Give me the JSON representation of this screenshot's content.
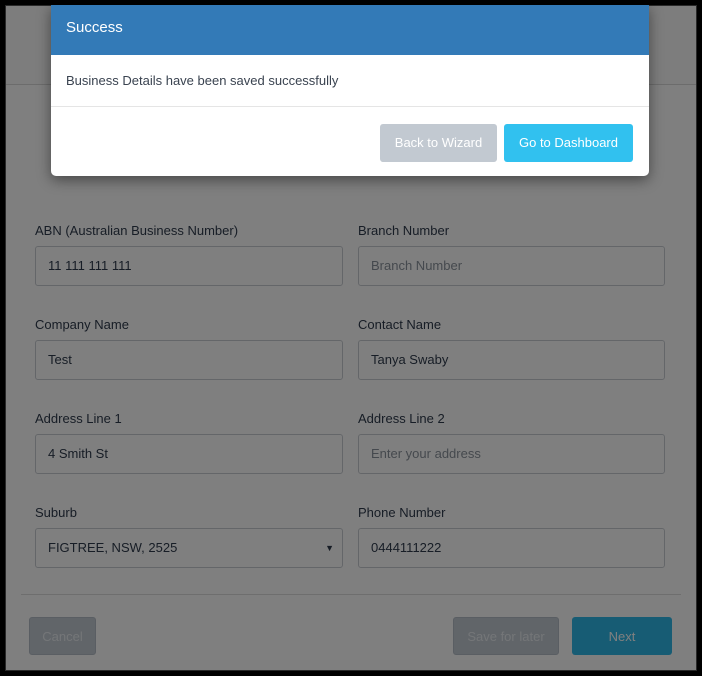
{
  "form": {
    "fields": [
      {
        "label": "ABN (Australian Business Number)",
        "value": "11 111 111 111",
        "placeholder": ""
      },
      {
        "label": "Branch Number",
        "value": "",
        "placeholder": "Branch Number"
      },
      {
        "label": "Company Name",
        "value": "Test",
        "placeholder": ""
      },
      {
        "label": "Contact Name",
        "value": "Tanya Swaby",
        "placeholder": ""
      },
      {
        "label": "Address Line 1",
        "value": "4 Smith St",
        "placeholder": ""
      },
      {
        "label": "Address Line 2",
        "value": "",
        "placeholder": "Enter your address"
      },
      {
        "label": "Suburb",
        "value": "FIGTREE, NSW, 2525",
        "placeholder": "",
        "caret": "▼"
      },
      {
        "label": "Phone Number",
        "value": "0444111222",
        "placeholder": ""
      }
    ],
    "buttons": {
      "cancel": "Cancel",
      "save_for_later": "Save for later",
      "next": "Next"
    }
  },
  "modal": {
    "title": "Success",
    "message": "Business Details have been saved successfully",
    "buttons": {
      "back": "Back to Wizard",
      "dashboard": "Go to Dashboard"
    }
  },
  "colors": {
    "modal_header": "#337ab7",
    "primary_button": "#31c1ef",
    "secondary_button": "#c2c9d1"
  }
}
